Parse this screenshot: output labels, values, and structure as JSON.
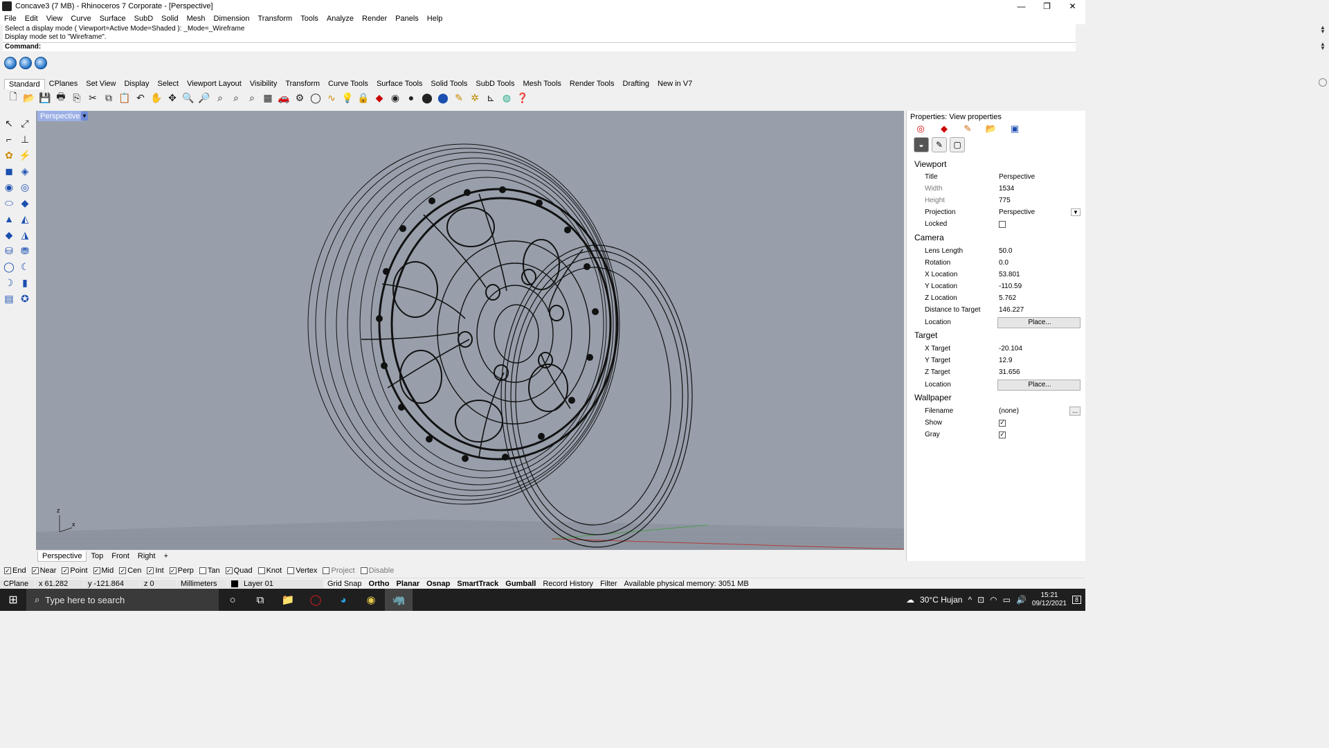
{
  "window": {
    "title": "Concave3 (7 MB) - Rhinoceros 7 Corporate - [Perspective]",
    "controls": [
      "—",
      "❐",
      "✕"
    ]
  },
  "menu": [
    "File",
    "Edit",
    "View",
    "Curve",
    "Surface",
    "SubD",
    "Solid",
    "Mesh",
    "Dimension",
    "Transform",
    "Tools",
    "Analyze",
    "Render",
    "Panels",
    "Help"
  ],
  "command": {
    "history": [
      "Select a display mode ( Viewport=Active  Mode=Shaded ): _Mode=_Wireframe",
      "Display mode set to \"Wireframe\"."
    ],
    "prompt": "Command:"
  },
  "toolbar_tabs": [
    "Standard",
    "CPlanes",
    "Set View",
    "Display",
    "Select",
    "Viewport Layout",
    "Visibility",
    "Transform",
    "Curve Tools",
    "Surface Tools",
    "Solid Tools",
    "SubD Tools",
    "Mesh Tools",
    "Render Tools",
    "Drafting",
    "New in V7"
  ],
  "standard_icons": [
    "new-file",
    "open-file",
    "save",
    "print",
    "import",
    "cut",
    "copy",
    "paste",
    "undo",
    "pan",
    "rotate-view",
    "zoom-dynamic",
    "zoom-window",
    "zoom-extents",
    "zoom-selected",
    "zoom-all",
    "grid",
    "car",
    "settings",
    "circle",
    "curve",
    "light",
    "lock",
    "material",
    "color-wheel",
    "sphere-gray",
    "sphere-dark",
    "sphere-blue",
    "select-pick",
    "gear",
    "dimension",
    "render",
    "help"
  ],
  "left_tools": [
    "pointer",
    "point-edit",
    "curve",
    "line",
    "polyline",
    "polygon",
    "box",
    "box-edit",
    "sphere",
    "sphere-edit",
    "ellipsoid",
    "ellipsoid-edit",
    "cone",
    "cone-edit",
    "pyramid",
    "pyramid-edit",
    "cylinder",
    "cylinder-edit",
    "torus",
    "torus-edit",
    "pipe",
    "pipe-edit",
    "surface",
    "solid-edit"
  ],
  "viewport": {
    "label": "Perspective",
    "bg": "#989fab",
    "axes": {
      "z": "z",
      "x": "x"
    }
  },
  "viewport_tabs": [
    "Perspective",
    "Top",
    "Front",
    "Right",
    "+"
  ],
  "osnaps": [
    {
      "label": "End",
      "checked": true
    },
    {
      "label": "Near",
      "checked": true
    },
    {
      "label": "Point",
      "checked": true
    },
    {
      "label": "Mid",
      "checked": true
    },
    {
      "label": "Cen",
      "checked": true
    },
    {
      "label": "Int",
      "checked": true
    },
    {
      "label": "Perp",
      "checked": true
    },
    {
      "label": "Tan",
      "checked": false
    },
    {
      "label": "Quad",
      "checked": true
    },
    {
      "label": "Knot",
      "checked": false
    },
    {
      "label": "Vertex",
      "checked": false
    },
    {
      "label": "Project",
      "checked": false,
      "dim": true
    },
    {
      "label": "Disable",
      "checked": false,
      "dim": true
    }
  ],
  "status": {
    "cplane": "CPlane",
    "x": "x 61.282",
    "y": "y -121.864",
    "z": "z 0",
    "units": "Millimeters",
    "layer": "Layer 01",
    "grid_snap": "Grid Snap",
    "ortho": "Ortho",
    "planar": "Planar",
    "osnap": "Osnap",
    "smarttrack": "SmartTrack",
    "gumball": "Gumball",
    "record_history": "Record History",
    "filter": "Filter",
    "memory": "Available physical memory: 3051 MB"
  },
  "panel": {
    "title": "Properties: View properties",
    "viewport_section": "Viewport",
    "title_label": "Title",
    "title_value": "Perspective",
    "width_label": "Width",
    "width_value": "1534",
    "height_label": "Height",
    "height_value": "775",
    "projection_label": "Projection",
    "projection_value": "Perspective",
    "locked_label": "Locked",
    "camera_section": "Camera",
    "lens_label": "Lens Length",
    "lens_value": "50.0",
    "rotation_label": "Rotation",
    "rotation_value": "0.0",
    "xloc_label": "X Location",
    "xloc_value": "53.801",
    "yloc_label": "Y Location",
    "yloc_value": "-110.59",
    "zloc_label": "Z Location",
    "zloc_value": "5.762",
    "dist_label": "Distance to Target",
    "dist_value": "146.227",
    "location_label": "Location",
    "place_label": "Place...",
    "target_section": "Target",
    "xt_label": "X Target",
    "xt_value": "-20.104",
    "yt_label": "Y Target",
    "yt_value": "12.9",
    "zt_label": "Z Target",
    "zt_value": "31.656",
    "tlocation_label": "Location",
    "tplace_label": "Place...",
    "wallpaper_section": "Wallpaper",
    "filename_label": "Filename",
    "filename_value": "(none)",
    "browse_label": "...",
    "show_label": "Show",
    "show_checked": true,
    "gray_label": "Gray",
    "gray_checked": true
  },
  "taskbar": {
    "search_placeholder": "Type here to search",
    "weather": "30°C Hujan",
    "time": "15:21",
    "date": "09/12/2021",
    "notifications": "8"
  }
}
